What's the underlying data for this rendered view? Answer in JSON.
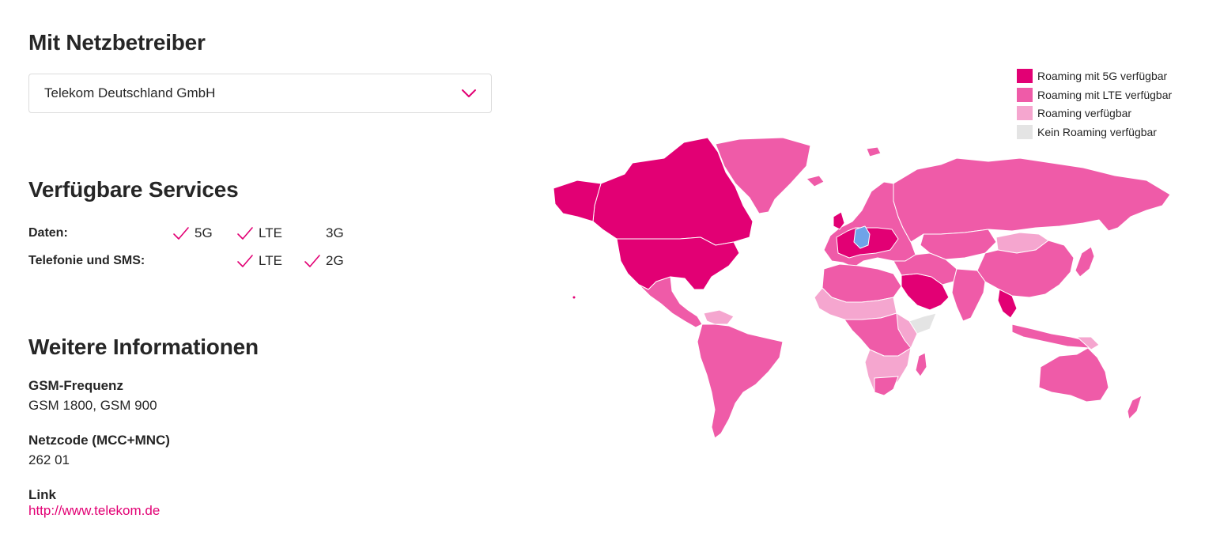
{
  "operator": {
    "heading": "Mit Netzbetreiber",
    "selected": "Telekom Deutschland GmbH",
    "dropdown_icon": "chevron-down-icon"
  },
  "services": {
    "heading": "Verfügbare Services",
    "rows": [
      {
        "label": "Daten:",
        "items": [
          {
            "text": "5G",
            "available": true
          },
          {
            "text": "LTE",
            "available": true
          },
          {
            "text": "3G",
            "available": false
          }
        ]
      },
      {
        "label": "Telefonie und SMS:",
        "items": [
          {
            "text": "LTE",
            "available": true
          },
          {
            "text": "2G",
            "available": true
          }
        ]
      }
    ],
    "check_icon": "check-icon"
  },
  "info": {
    "heading": "Weitere Informationen",
    "gsm_label": "GSM-Frequenz",
    "gsm_value": "GSM 1800, GSM 900",
    "netcode_label": "Netzcode (MCC+MNC)",
    "netcode_value": "262 01",
    "link_label": "Link",
    "link_value": "http://www.telekom.de"
  },
  "legend": [
    {
      "label": "Roaming mit 5G verfügbar",
      "color": "#e20074"
    },
    {
      "label": "Roaming mit LTE verfügbar",
      "color": "#ef5ba8"
    },
    {
      "label": "Roaming verfügbar",
      "color": "#f5a6cf"
    },
    {
      "label": "Kein Roaming verfügbar",
      "color": "#e4e4e4"
    }
  ],
  "map": {
    "home_color": "#6fa3e8",
    "border_color": "#ffffff"
  },
  "colors": {
    "accent": "#e20074",
    "text": "#262626"
  }
}
